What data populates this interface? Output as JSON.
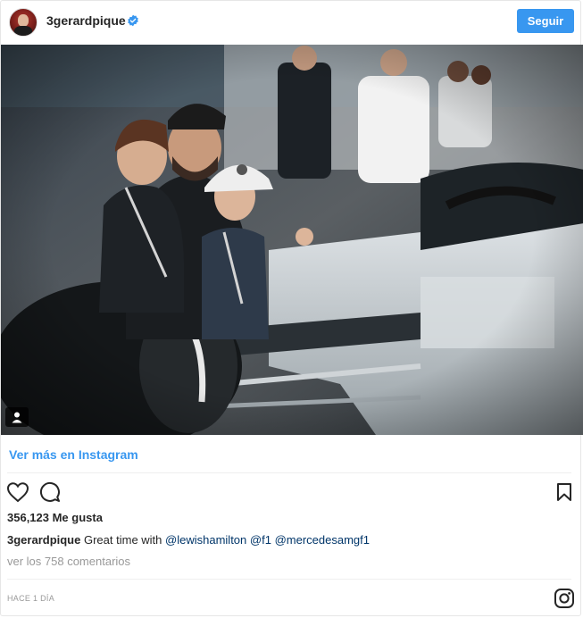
{
  "post": {
    "username": "3gerardpique",
    "follow_label": "Seguir",
    "view_more_label": "Ver más en Instagram",
    "likes_text": "356,123 Me gusta",
    "caption": {
      "username": "3gerardpique",
      "text": "Great time with",
      "mentions": [
        "@lewishamilton",
        "@f1",
        "@mercedesamgf1"
      ]
    },
    "comments_link": "ver los 758 comentarios",
    "timestamp": "HACE 1 DÍA"
  },
  "icons": {
    "verified": "verified-badge-icon",
    "like": "heart-icon",
    "comment": "comment-icon",
    "save": "bookmark-icon",
    "user_tag": "user-tag-icon",
    "logo": "instagram-logo-icon"
  },
  "colors": {
    "accent": "#3897f0",
    "text": "#262626",
    "muted": "#999999",
    "mention": "#003569"
  }
}
